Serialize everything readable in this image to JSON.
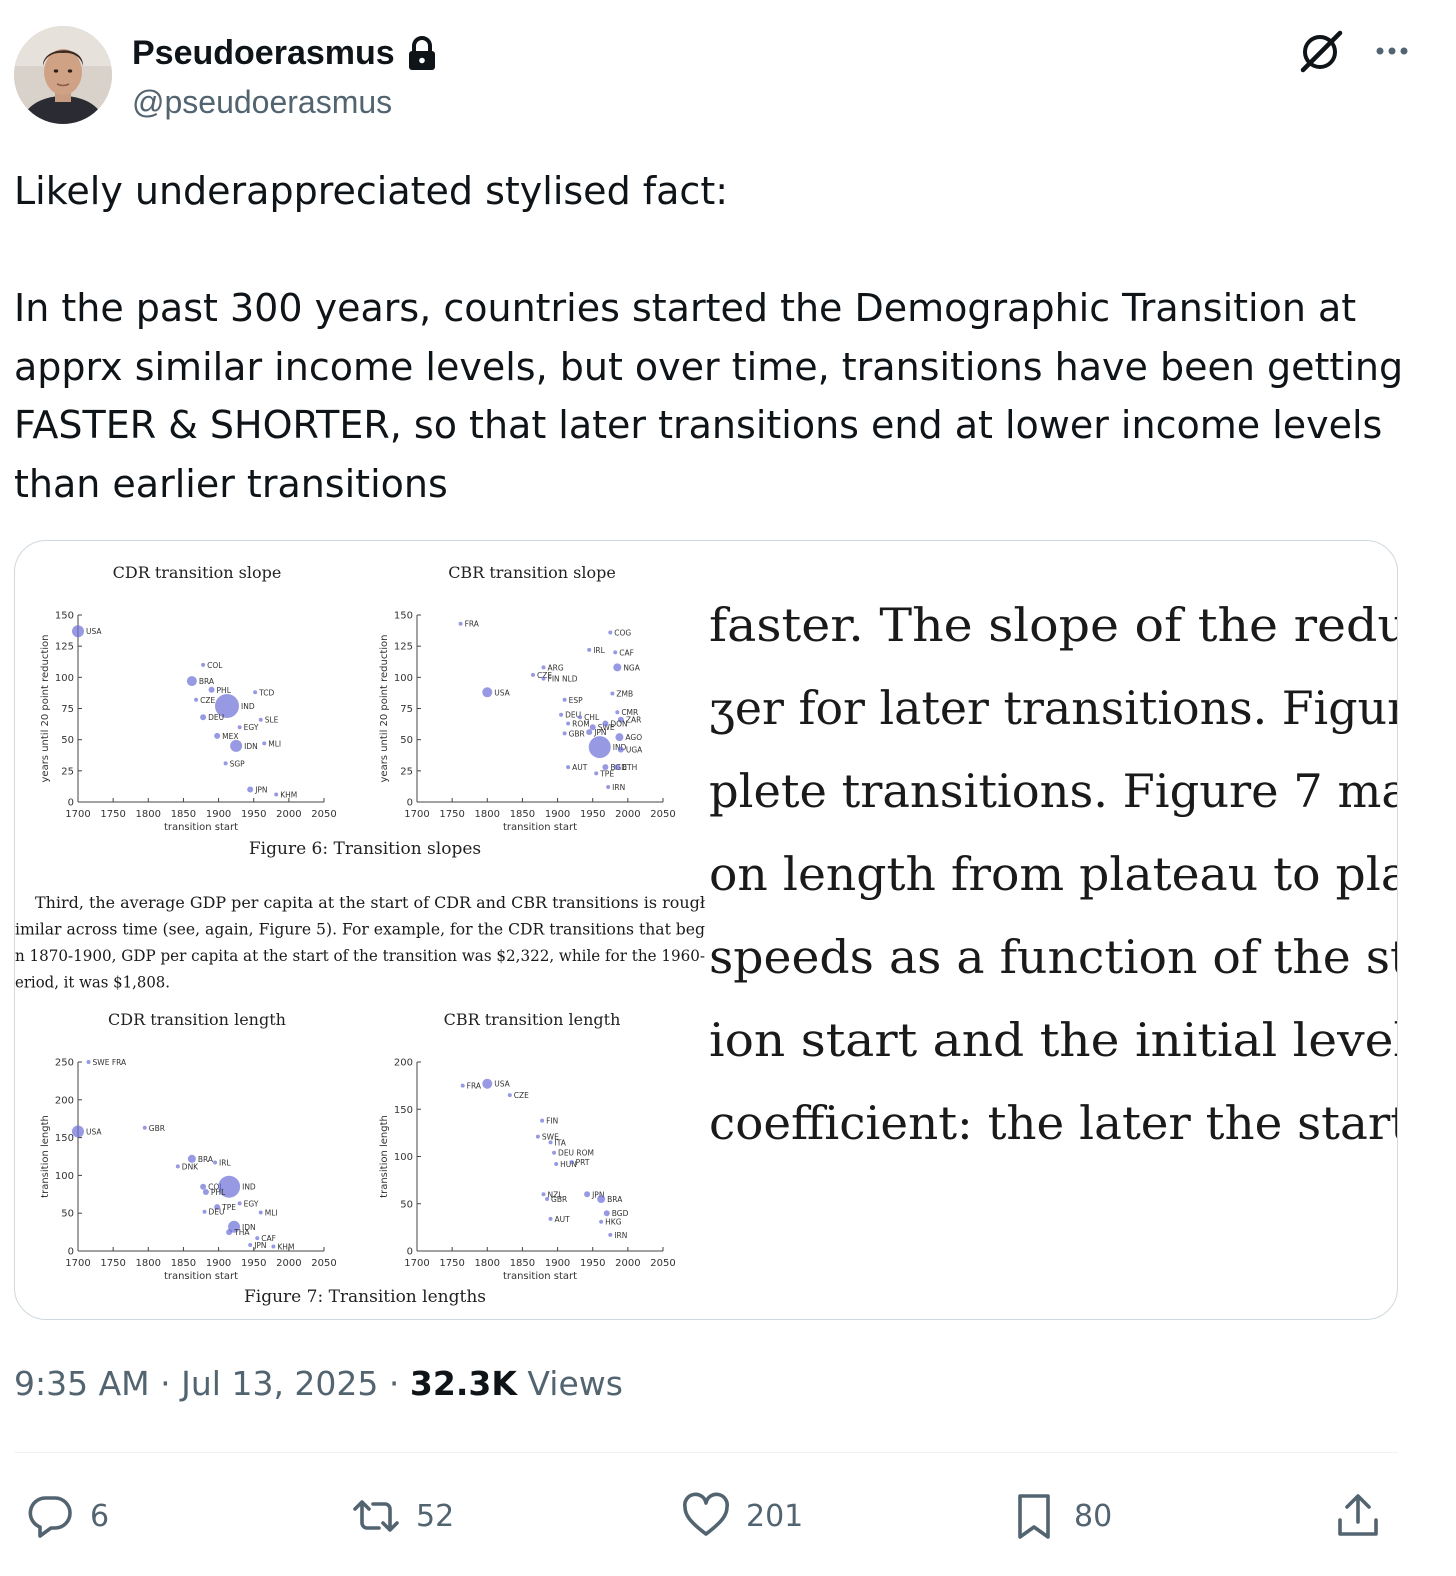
{
  "author": {
    "display_name": "Pseudoerasmus",
    "handle": "@pseudoerasmus"
  },
  "tweet": {
    "text": "Likely underappreciated stylised fact:\n\nIn the past 300 years, countries started the Demographic Transition at apprx similar income levels, but over time, transitions have been getting FASTER & SHORTER, so that later transitions end at lower income levels than earlier transitions",
    "time": "9:35 AM",
    "date": "Jul 13, 2025",
    "views_count": "32.3K",
    "views_label": "Views",
    "separator": "·"
  },
  "stats": {
    "replies": "6",
    "reposts": "52",
    "likes": "201",
    "bookmarks": "80"
  },
  "icons": {
    "lock": "lock-icon",
    "grok": "grok-icon",
    "more": "more-icon",
    "reply": "reply-icon",
    "repost": "repost-icon",
    "like": "like-icon",
    "bookmark": "bookmark-icon",
    "share": "share-icon"
  },
  "colors": {
    "text_primary": "#0f1419",
    "text_secondary": "#536471",
    "border": "#cfd9de",
    "bubble": "#6b6fd6",
    "link": "#3b4fb8"
  },
  "media": {
    "figure6_caption": "Figure 6: Transition slopes",
    "figure7_caption": "Figure 7: Transition lengths",
    "paragraph_lines": [
      "Third, the average GDP per capita at the start of CDR and CBR transitions is rougł",
      "imilar across time (see, again, Figure 5). For example, for the CDR transitions that beg",
      "n 1870-1900, GDP per capita at the start of the transition was $2,322, while for the 1960-",
      "eriod, it was $1,808."
    ],
    "zoom_lines": [
      "faster.  The slope of the redu",
      "ʒer for later transitions.  Figur",
      "plete transitions.  Figure 7 ma",
      "on length from plateau to pla",
      " speeds as a function of the st",
      "ion start and the initial level",
      "coefficient:  the later the start"
    ],
    "charts": [
      {
        "title": "CDR transition slope",
        "type": "scatter",
        "xlabel": "transition start",
        "ylabel": "years until 20 point reduction",
        "xlim": [
          1700,
          2050
        ],
        "ylim": [
          0,
          150
        ],
        "xticks": [
          1700,
          1750,
          1800,
          1850,
          1900,
          1950,
          2000,
          2050
        ],
        "yticks": [
          0,
          25,
          50,
          75,
          100,
          125,
          150
        ],
        "points": [
          {
            "label": "USA",
            "x": 1700,
            "y": 137,
            "size": 6
          },
          {
            "label": "COL",
            "x": 1878,
            "y": 110,
            "size": 2
          },
          {
            "label": "BRA",
            "x": 1862,
            "y": 97,
            "size": 5
          },
          {
            "label": "PHL",
            "x": 1890,
            "y": 90,
            "size": 3
          },
          {
            "label": "TCD",
            "x": 1952,
            "y": 88,
            "size": 2
          },
          {
            "label": "CZE",
            "x": 1868,
            "y": 82,
            "size": 2
          },
          {
            "label": "IND",
            "x": 1912,
            "y": 77,
            "size": 12
          },
          {
            "label": "DEU",
            "x": 1878,
            "y": 68,
            "size": 3
          },
          {
            "label": "SLE",
            "x": 1960,
            "y": 66,
            "size": 2
          },
          {
            "label": "EGY",
            "x": 1930,
            "y": 60,
            "size": 2
          },
          {
            "label": "MEX",
            "x": 1898,
            "y": 53,
            "size": 3
          },
          {
            "label": "IDN",
            "x": 1925,
            "y": 45,
            "size": 6
          },
          {
            "label": "MLI",
            "x": 1965,
            "y": 47,
            "size": 2
          },
          {
            "label": "SGP",
            "x": 1910,
            "y": 31,
            "size": 2
          },
          {
            "label": "JPN",
            "x": 1945,
            "y": 10,
            "size": 3
          },
          {
            "label": "KHM",
            "x": 1982,
            "y": 6,
            "size": 2
          }
        ]
      },
      {
        "title": "CBR transition slope",
        "type": "scatter",
        "xlabel": "transition start",
        "ylabel": "years until 20 point reduction",
        "xlim": [
          1700,
          2050
        ],
        "ylim": [
          0,
          150
        ],
        "xticks": [
          1700,
          1750,
          1800,
          1850,
          1900,
          1950,
          2000,
          2050
        ],
        "yticks": [
          0,
          25,
          50,
          75,
          100,
          125,
          150
        ],
        "points": [
          {
            "label": "FRA",
            "x": 1762,
            "y": 143,
            "size": 2
          },
          {
            "label": "COG",
            "x": 1975,
            "y": 136,
            "size": 2
          },
          {
            "label": "IRL",
            "x": 1945,
            "y": 122,
            "size": 2
          },
          {
            "label": "CAF",
            "x": 1982,
            "y": 120,
            "size": 2
          },
          {
            "label": "NGA",
            "x": 1985,
            "y": 108,
            "size": 4
          },
          {
            "label": "ARG",
            "x": 1880,
            "y": 108,
            "size": 2
          },
          {
            "label": "CZE",
            "x": 1865,
            "y": 102,
            "size": 2
          },
          {
            "label": "FIN NLD",
            "x": 1880,
            "y": 99,
            "size": 2
          },
          {
            "label": "USA",
            "x": 1800,
            "y": 88,
            "size": 5
          },
          {
            "label": "ZMB",
            "x": 1978,
            "y": 87,
            "size": 2
          },
          {
            "label": "ESP",
            "x": 1910,
            "y": 82,
            "size": 2
          },
          {
            "label": "DEU",
            "x": 1905,
            "y": 70,
            "size": 2
          },
          {
            "label": "CHL",
            "x": 1932,
            "y": 68,
            "size": 2
          },
          {
            "label": "CMR",
            "x": 1985,
            "y": 72,
            "size": 2
          },
          {
            "label": "ZAR",
            "x": 1990,
            "y": 66,
            "size": 3
          },
          {
            "label": "ROM",
            "x": 1915,
            "y": 63,
            "size": 2
          },
          {
            "label": "SWE",
            "x": 1950,
            "y": 60,
            "size": 3
          },
          {
            "label": "DON",
            "x": 1968,
            "y": 63,
            "size": 3
          },
          {
            "label": "GBR",
            "x": 1910,
            "y": 55,
            "size": 2
          },
          {
            "label": "JPN",
            "x": 1945,
            "y": 56,
            "size": 3
          },
          {
            "label": "AGO",
            "x": 1988,
            "y": 52,
            "size": 4
          },
          {
            "label": "IND",
            "x": 1960,
            "y": 44,
            "size": 11
          },
          {
            "label": "UGA",
            "x": 1990,
            "y": 42,
            "size": 3
          },
          {
            "label": "AUT",
            "x": 1915,
            "y": 28,
            "size": 2
          },
          {
            "label": "BGD",
            "x": 1968,
            "y": 28,
            "size": 3
          },
          {
            "label": "ETH",
            "x": 1985,
            "y": 28,
            "size": 3
          },
          {
            "label": "TPE",
            "x": 1955,
            "y": 23,
            "size": 2
          },
          {
            "label": "IRN",
            "x": 1972,
            "y": 12,
            "size": 2
          }
        ]
      },
      {
        "title": "CDR transition length",
        "type": "scatter",
        "xlabel": "transition start",
        "ylabel": "transition length",
        "xlim": [
          1700,
          2050
        ],
        "ylim": [
          0,
          250
        ],
        "xticks": [
          1700,
          1750,
          1800,
          1850,
          1900,
          1950,
          2000,
          2050
        ],
        "yticks": [
          0,
          50,
          100,
          150,
          200,
          250
        ],
        "points": [
          {
            "label": "SWE FRA",
            "x": 1715,
            "y": 250,
            "size": 2
          },
          {
            "label": "USA",
            "x": 1700,
            "y": 158,
            "size": 6
          },
          {
            "label": "GBR",
            "x": 1795,
            "y": 163,
            "size": 2
          },
          {
            "label": "BRA",
            "x": 1862,
            "y": 122,
            "size": 4
          },
          {
            "label": "DNK",
            "x": 1842,
            "y": 112,
            "size": 2
          },
          {
            "label": "IRL",
            "x": 1895,
            "y": 117,
            "size": 2
          },
          {
            "label": "COL",
            "x": 1878,
            "y": 85,
            "size": 3
          },
          {
            "label": "IND",
            "x": 1915,
            "y": 85,
            "size": 11
          },
          {
            "label": "PHL",
            "x": 1882,
            "y": 78,
            "size": 3
          },
          {
            "label": "EGY",
            "x": 1930,
            "y": 63,
            "size": 2
          },
          {
            "label": "TPE",
            "x": 1898,
            "y": 58,
            "size": 3
          },
          {
            "label": "DEU",
            "x": 1880,
            "y": 52,
            "size": 2
          },
          {
            "label": "MLI",
            "x": 1960,
            "y": 51,
            "size": 2
          },
          {
            "label": "IDN",
            "x": 1922,
            "y": 32,
            "size": 6
          },
          {
            "label": "THA",
            "x": 1915,
            "y": 25,
            "size": 3
          },
          {
            "label": "CAF",
            "x": 1955,
            "y": 17,
            "size": 2
          },
          {
            "label": "JPN",
            "x": 1945,
            "y": 8,
            "size": 2
          },
          {
            "label": "KHM",
            "x": 1978,
            "y": 6,
            "size": 2
          }
        ]
      },
      {
        "title": "CBR transition length",
        "type": "scatter",
        "xlabel": "transition start",
        "ylabel": "transition length",
        "xlim": [
          1700,
          2050
        ],
        "ylim": [
          0,
          200
        ],
        "xticks": [
          1700,
          1750,
          1800,
          1850,
          1900,
          1950,
          2000,
          2050
        ],
        "yticks": [
          0,
          50,
          100,
          150,
          200
        ],
        "points": [
          {
            "label": "FRA",
            "x": 1765,
            "y": 175,
            "size": 2
          },
          {
            "label": "USA",
            "x": 1800,
            "y": 177,
            "size": 5
          },
          {
            "label": "CZE",
            "x": 1832,
            "y": 165,
            "size": 2
          },
          {
            "label": "FIN",
            "x": 1878,
            "y": 138,
            "size": 2
          },
          {
            "label": "SWE",
            "x": 1872,
            "y": 121,
            "size": 2
          },
          {
            "label": "ITA",
            "x": 1890,
            "y": 115,
            "size": 2
          },
          {
            "label": "DEU ROM",
            "x": 1895,
            "y": 104,
            "size": 2
          },
          {
            "label": "HUN",
            "x": 1898,
            "y": 92,
            "size": 2
          },
          {
            "label": "PRT",
            "x": 1920,
            "y": 94,
            "size": 2
          },
          {
            "label": "NZL",
            "x": 1880,
            "y": 60,
            "size": 2
          },
          {
            "label": "GBR",
            "x": 1885,
            "y": 55,
            "size": 2
          },
          {
            "label": "JPN",
            "x": 1942,
            "y": 60,
            "size": 3
          },
          {
            "label": "BRA",
            "x": 1962,
            "y": 55,
            "size": 4
          },
          {
            "label": "AUT",
            "x": 1890,
            "y": 34,
            "size": 2
          },
          {
            "label": "BGD",
            "x": 1970,
            "y": 40,
            "size": 3
          },
          {
            "label": "HKG",
            "x": 1962,
            "y": 31,
            "size": 2
          },
          {
            "label": "IRN",
            "x": 1975,
            "y": 17,
            "size": 2
          }
        ]
      }
    ]
  }
}
